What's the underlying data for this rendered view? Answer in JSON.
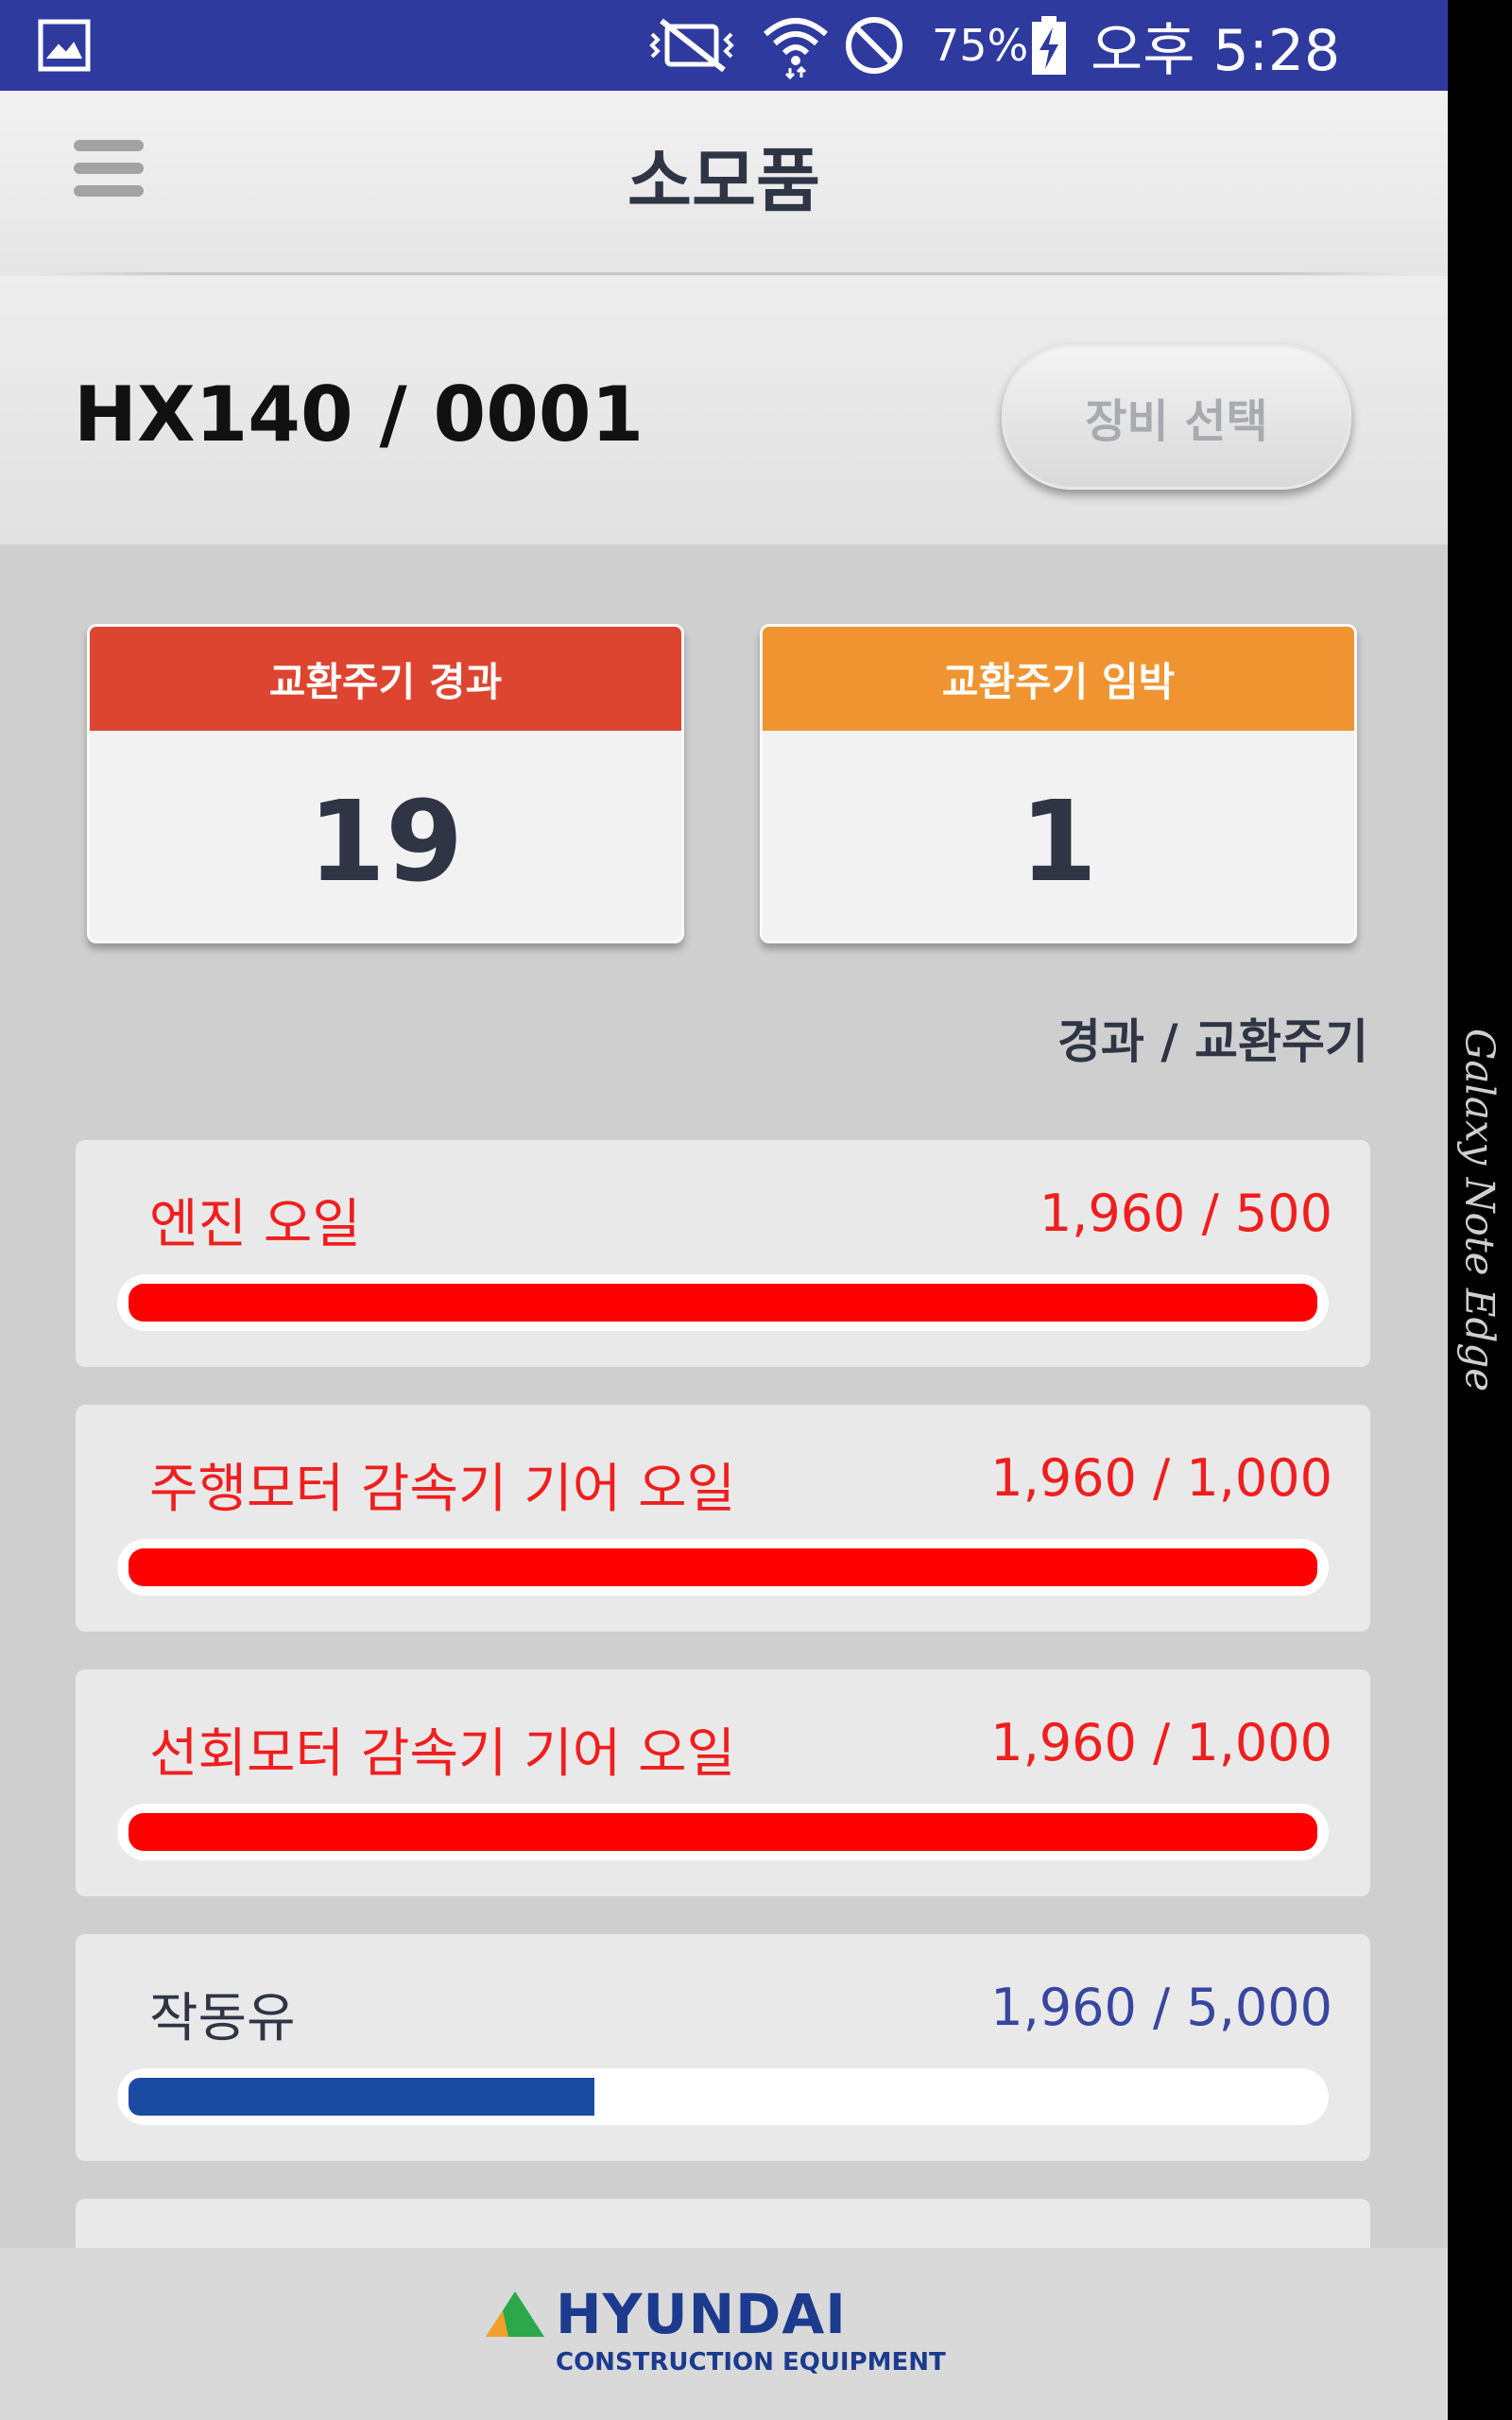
{
  "status_bar": {
    "battery_percent": "75%",
    "time": "오후 5:28",
    "icons": [
      "gallery-icon",
      "vibrate-mute-icon",
      "wifi-icon",
      "do-not-disturb-icon",
      "battery-charging-icon"
    ]
  },
  "header": {
    "title": "소모품",
    "menu_icon": "hamburger-menu-icon"
  },
  "machine": {
    "id": "HX140 / 0001",
    "select_button_label": "장비 선택"
  },
  "summary": {
    "overdue": {
      "label": "교환주기 경과",
      "count": "19",
      "color": "#de4530"
    },
    "due_soon": {
      "label": "교환주기 임박",
      "count": "1",
      "color": "#f09431"
    }
  },
  "list": {
    "column_caption": "경과 / 교환주기",
    "items": [
      {
        "name": "엔진 오일",
        "value": "1,960 / 500",
        "status": "over",
        "progress": 1.0
      },
      {
        "name": "주행모터 감속기 기어 오일",
        "value": "1,960 / 1,000",
        "status": "over",
        "progress": 1.0
      },
      {
        "name": "선회모터 감속기 기어 오일",
        "value": "1,960 / 1,000",
        "status": "over",
        "progress": 1.0
      },
      {
        "name": "작동유",
        "value": "1,960 / 5,000",
        "status": "ok",
        "progress": 0.392
      }
    ]
  },
  "footer": {
    "brand": "HYUNDAI",
    "brand_sub": "CONSTRUCTION EQUIPMENT"
  },
  "device_edge_label": "Galaxy Note Edge",
  "colors": {
    "status_bar": "#2f3a9f",
    "overdue_red": "#ff0000",
    "normal_blue": "#1b4aa3"
  }
}
